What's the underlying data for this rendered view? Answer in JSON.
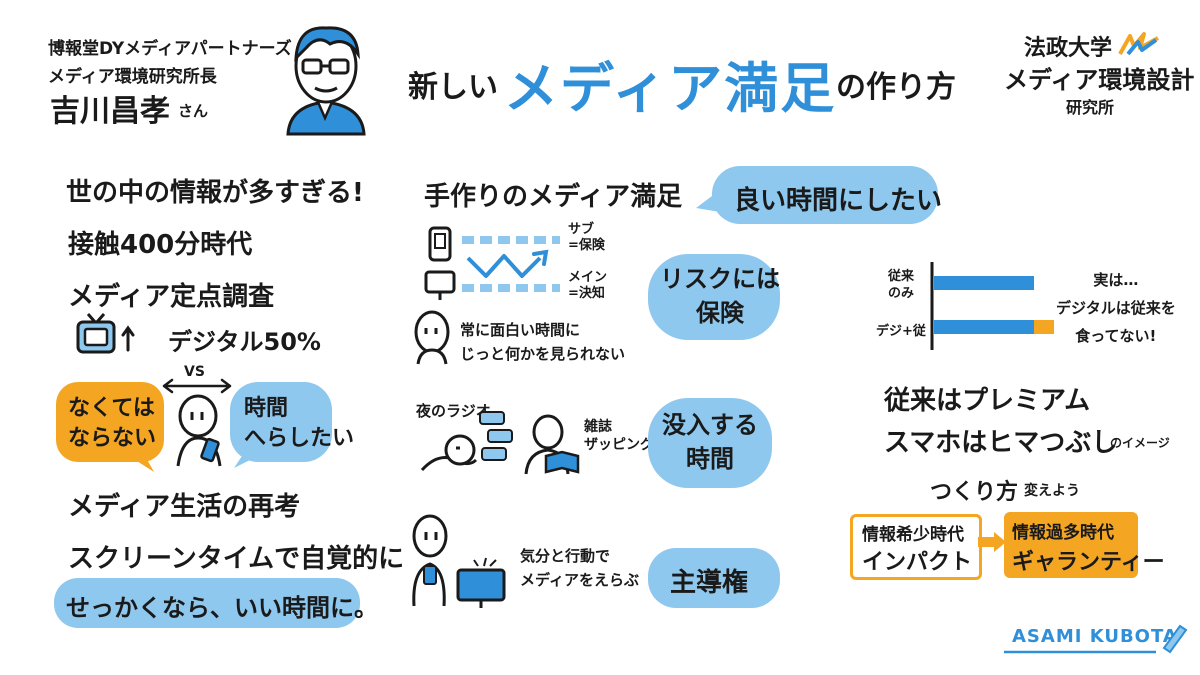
{
  "speaker": {
    "affiliation_1": "博報堂DYメディアパートナーズ",
    "affiliation_2": "メディア環境研究所長",
    "name": "吉川昌孝",
    "honorific": "さん"
  },
  "title": {
    "prefix": "新しい",
    "main": "メディア満足",
    "suffix": "の作り方"
  },
  "institute": {
    "line1": "法政大学",
    "line2": "メディア環境設計",
    "line3": "研究所"
  },
  "left": {
    "headline": "世の中の情報が多すぎる!",
    "contact_time": "接触400分時代",
    "survey": "メディア定点調査",
    "digital": "デジタル50%",
    "must_have": "なくては\nならない",
    "vs": "VS",
    "reduce_time": "時間\nへらしたい",
    "rethink": "メディア生活の再考",
    "screen_time": "スクリーンタイムで自覚的に",
    "good_time": "せっかくなら、いい時間に。"
  },
  "center": {
    "handmade": "手作りのメディア満足",
    "good_time_bubble": "良い時間にしたい",
    "sub_label": "サブ\n=保険",
    "main_label": "メイン\n=決知",
    "risk_bubble": "リスクには\n保険",
    "always_fun": "常に面白い時間に\nじっと何かを見られない",
    "night_radio": "夜のラジオ",
    "magazine": "雑誌\nザッピング",
    "immersive_bubble": "没入する\n時間",
    "choose_media": "気分と行動で\nメディアをえらぶ",
    "initiative_bubble": "主導権"
  },
  "right": {
    "label_traditional": "従来\nのみ",
    "label_digital": "デジ+従",
    "note": "実は…\nデジタルは従来を\n食ってない!",
    "premium": "従来はプレミアム",
    "smartphone": "スマホはヒマつぶし",
    "image_suffix": "のイメージ",
    "change_method": "つくり方",
    "change_suffix": "変えよう",
    "scarcity_era": "情報希少時代",
    "impact": "インパクト",
    "overload_era": "情報過多時代",
    "guarantee": "ギャランティー"
  },
  "chart_data": {
    "type": "bar",
    "categories": [
      "従来のみ",
      "デジ+従"
    ],
    "series": [
      {
        "values": [
          1.0,
          1.0
        ]
      },
      {
        "values": [
          0,
          0.2
        ]
      }
    ]
  },
  "signature": "ASAMI KUBOTA",
  "colors": {
    "blue": "#2f8fd8",
    "light_blue": "#8fc8ee",
    "orange": "#f4a623",
    "ink": "#1a1a1a"
  }
}
